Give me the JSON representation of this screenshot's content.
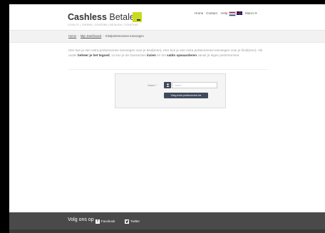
{
  "logo": {
    "brand_bold": "Cashless",
    "brand_regular": "Betalen",
    "tagline": "LOYALTY | TOKENS | COUPONS | BETALEN | TICKETING"
  },
  "nav": {
    "home": "Home",
    "contact": "Contact",
    "help": "Help",
    "user": "Marco"
  },
  "breadcrumb": {
    "home": "Home",
    "dashboard": "Mijn Dashboard",
    "current": "Kindportemonnee toevoegen"
  },
  "intro": {
    "part1": "Hier kun je een extra portemonnee toevoegen voor je kind(eren). Hier kun je een extra portemonnee toevoegen voor je kind(eren). Als ouder ",
    "bold1": "beheer je het tegoed",
    "part2": ", zo kun je de transacties ",
    "bold2": "inzien",
    "part3": " en het ",
    "bold3": "saldo opwaarderen",
    "part4": " vanuit je eigen portemonnee."
  },
  "form": {
    "name_label": "Naam",
    "required_mark": "*",
    "name_placeholder": "Naam",
    "name_value": "",
    "submit_label": "Voeg extra portemonnee toe"
  },
  "footer": {
    "follow_label": "Volg ons op",
    "facebook": "Facebook",
    "twitter": "Twitter"
  },
  "colors": {
    "accent": "#c8dc1e",
    "button": "#3f4a5c",
    "footer": "#4a4a4a"
  }
}
